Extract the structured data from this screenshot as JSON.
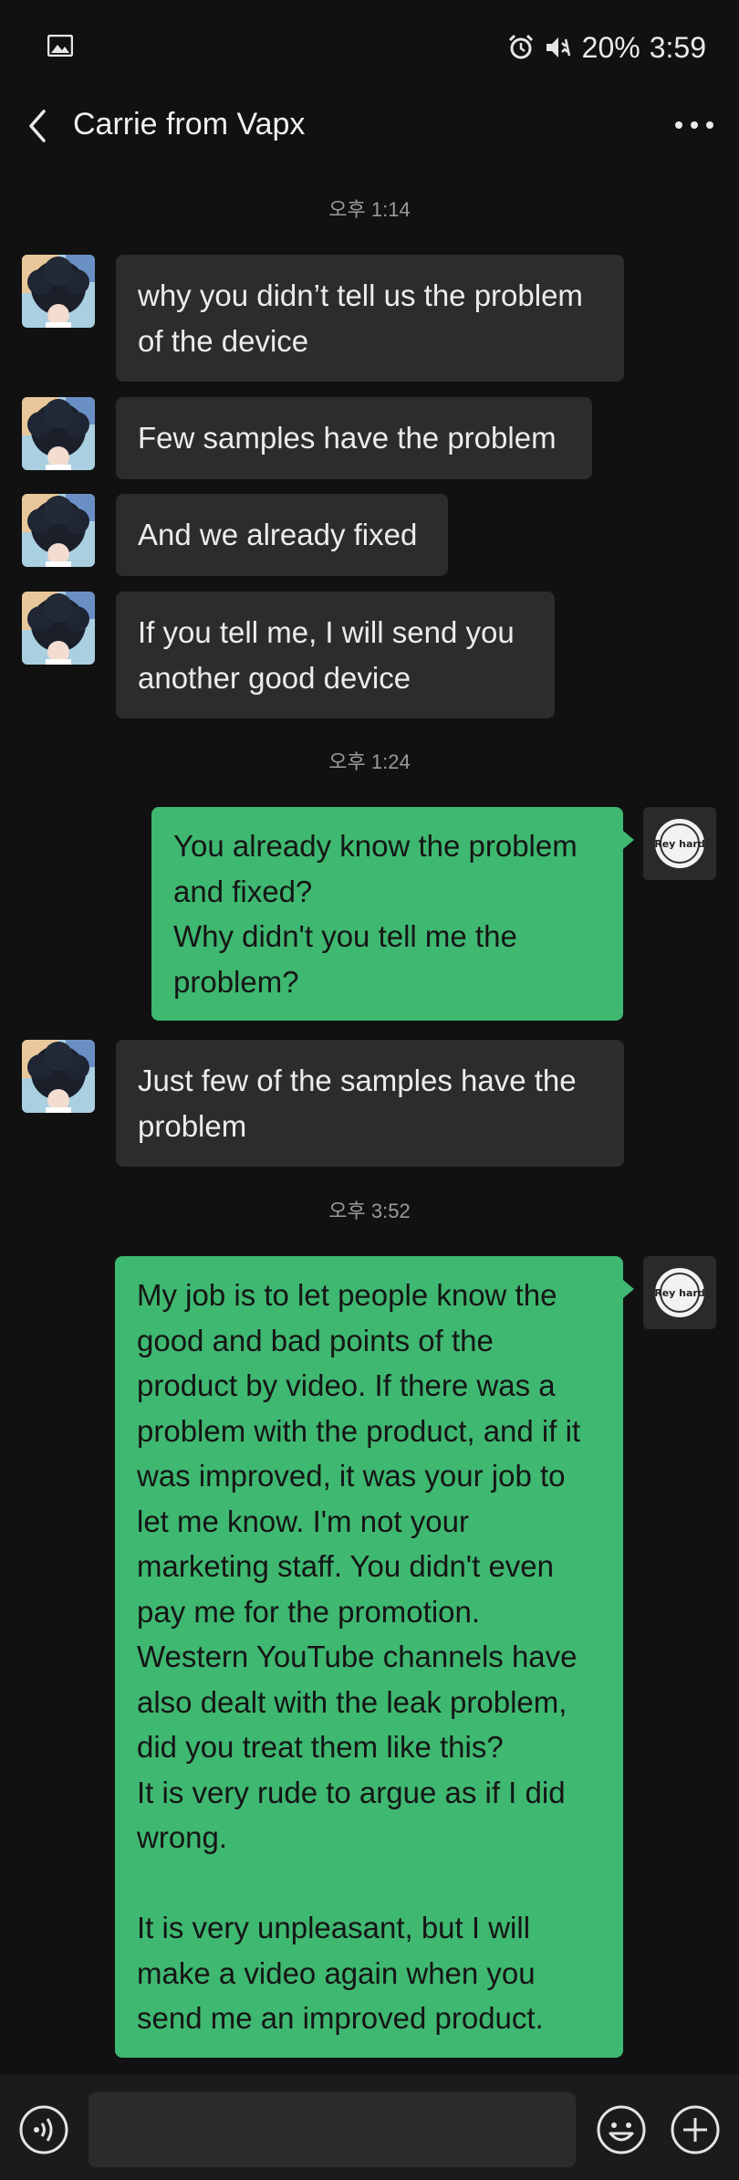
{
  "status": {
    "battery": "20%",
    "time": "3:59"
  },
  "header": {
    "title": "Carrie from Vapx"
  },
  "timestamps": [
    "오후 1:14",
    "오후 1:24",
    "오후 3:52"
  ],
  "messages": [
    {
      "sender": "Carrie from Vapx",
      "lines": [
        " why you didn’t tell us the problem",
        "of the device"
      ]
    },
    {
      "sender": "Carrie from Vapx",
      "lines": [
        "Few samples have the problem"
      ]
    },
    {
      "sender": "Carrie from Vapx",
      "lines": [
        "And we already fixed"
      ]
    },
    {
      "sender": "Carrie from Vapx",
      "lines": [
        "If you tell me, I will send you",
        "another good device"
      ]
    },
    {
      "sender": "me",
      "lines": [
        "You already know the problem",
        "and fixed?",
        "Why didn't you tell me the",
        "problem?"
      ]
    },
    {
      "sender": "Carrie from Vapx",
      "lines": [
        "Just few of the samples have the",
        "problem"
      ]
    },
    {
      "sender": "me",
      "lines": [
        "My job is to let people know the",
        "good and bad points of the",
        "product by video. If there was a",
        "problem with the product, and if it",
        "was improved, it was your job to",
        "let me know. I'm not your",
        "marketing staff. You didn't even",
        "pay me for the promotion.",
        "Western YouTube channels have",
        "also dealt with the leak problem,",
        "did you treat them like this?",
        "It is very rude to argue as if I did",
        "wrong.",
        "",
        "It is very unpleasant, but I will",
        "make a video again when you",
        "send me an improved product."
      ]
    }
  ],
  "my_avatar": {
    "logo_text": "Rey hard"
  },
  "composer": {
    "value": "",
    "placeholder": ""
  },
  "colors": {
    "background": "#111111",
    "incoming_bubble": "#2c2c2c",
    "outgoing_bubble": "#3fb871",
    "bottom_bar": "#1b1b1b"
  }
}
